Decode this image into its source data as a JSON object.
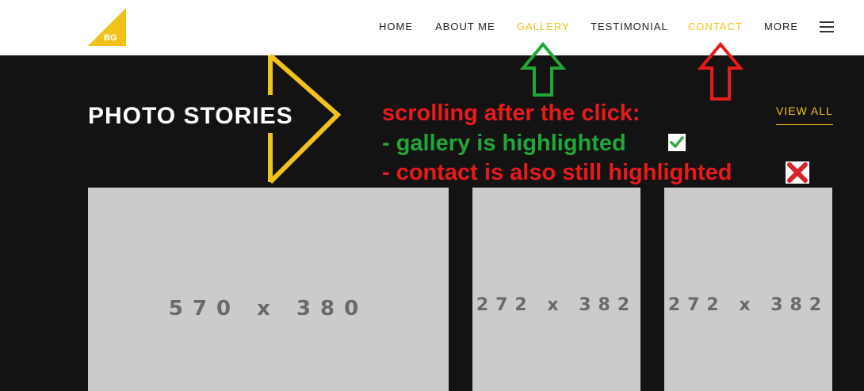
{
  "logo": {
    "text": "BG",
    "color": "#f2c21b"
  },
  "nav": {
    "items": [
      {
        "label": "HOME",
        "active": false
      },
      {
        "label": "ABOUT ME",
        "active": false
      },
      {
        "label": "GALLERY",
        "active": true
      },
      {
        "label": "TESTIMONIAL",
        "active": false
      },
      {
        "label": "CONTACT",
        "active": true
      },
      {
        "label": "MORE",
        "active": false
      }
    ],
    "menu_icon": "hamburger-icon",
    "active_color": "#f2c21b"
  },
  "section": {
    "title": "PHOTO STORIES",
    "view_all": "VIEW ALL"
  },
  "annotation": {
    "line1": "scrolling after the click:",
    "line2": "- gallery is highlighted",
    "line3": "- contact is also still highlighted",
    "check_icon": "check-icon",
    "cross_icon": "cross-icon",
    "colors": {
      "red": "#ea1a1a",
      "green": "#21a637",
      "yellow": "#f2c21b"
    }
  },
  "photos": [
    {
      "label": "570x380"
    },
    {
      "label": "272x382"
    },
    {
      "label": "272x382"
    }
  ]
}
